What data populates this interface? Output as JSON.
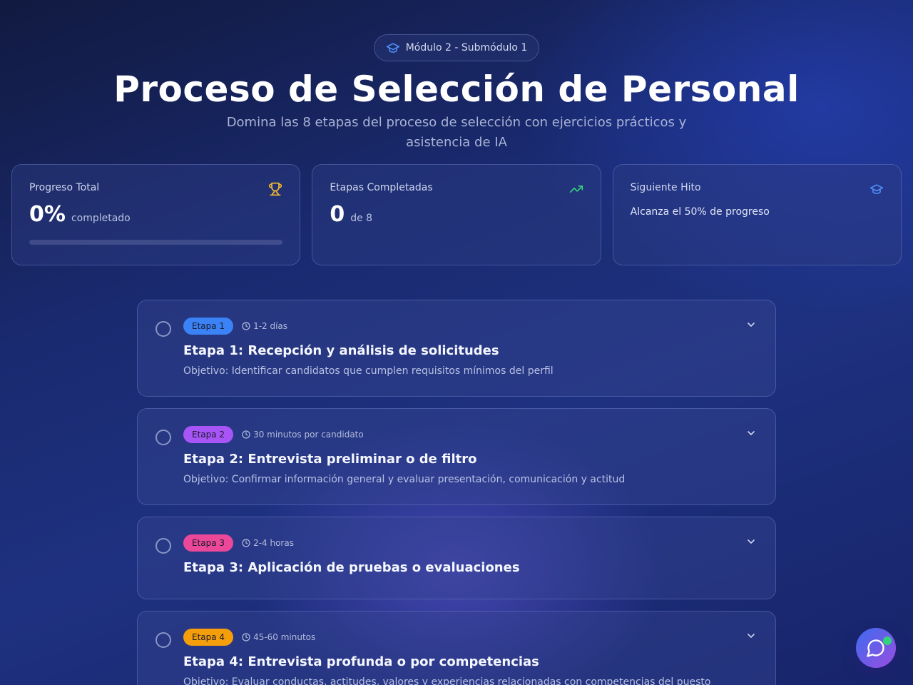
{
  "header": {
    "badge_label": "Módulo 2 - Submódulo 1",
    "badge_icon": "graduation-cap-icon",
    "title": "Proceso de Selección de Personal",
    "subtitle": "Domina las 8 etapas del proceso de selección con ejercicios prácticos y asistencia de IA"
  },
  "stats": {
    "progress": {
      "label": "Progreso Total",
      "value": "0%",
      "unit": "completado",
      "fraction": 0,
      "icon": "trophy-icon",
      "icon_color": "#f5b82e"
    },
    "completed": {
      "label": "Etapas Completadas",
      "value": "0",
      "unit": "de 8",
      "icon": "trending-up-icon",
      "icon_color": "#34d27a"
    },
    "milestone": {
      "label": "Siguiente Hito",
      "text": "Alcanza el 50% de progreso",
      "icon": "graduation-cap-icon",
      "icon_color": "#4f8cf7"
    }
  },
  "stages": [
    {
      "tag": "Etapa 1",
      "tag_color": "#3b82f6",
      "duration": "1-2 días",
      "title": "Etapa 1: Recepción y análisis de solicitudes",
      "objective": "Objetivo: Identificar candidatos que cumplen requisitos mínimos del perfil"
    },
    {
      "tag": "Etapa 2",
      "tag_color": "#a855f7",
      "duration": "30 minutos por candidato",
      "title": "Etapa 2: Entrevista preliminar o de filtro",
      "objective": "Objetivo: Confirmar información general y evaluar presentación, comunicación y actitud"
    },
    {
      "tag": "Etapa 3",
      "tag_color": "#ec4899",
      "duration": "2-4 horas",
      "title": "Etapa 3: Aplicación de pruebas o evaluaciones",
      "objective": ""
    },
    {
      "tag": "Etapa 4",
      "tag_color": "#f59e0b",
      "duration": "45-60 minutos",
      "title": "Etapa 4: Entrevista profunda o por competencias",
      "objective": "Objetivo: Evaluar conductas, actitudes, valores y experiencias relacionadas con competencias del puesto"
    }
  ],
  "chat": {
    "icon": "chat-bubble-icon",
    "status_color": "#34d27a"
  }
}
